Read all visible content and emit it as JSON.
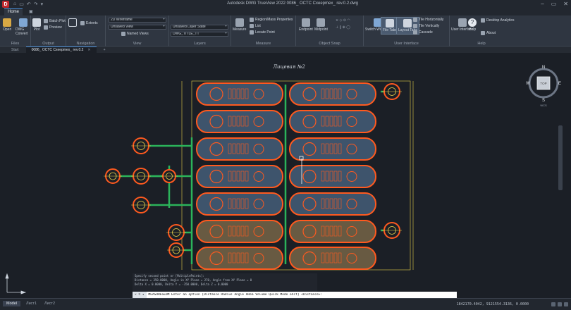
{
  "app": {
    "logo_letter": "D",
    "window_title": "Autodesk DWG TrueView 2022   0086_ OCTC Cxeepmex_ rev.0.2.dwg",
    "quick_access": [
      "⌂",
      "▭",
      "↶",
      "↷",
      "▾"
    ]
  },
  "ribbon_tabs": [
    {
      "label": "Home",
      "active": true
    },
    {
      "label": "▣",
      "active": false
    }
  ],
  "ribbon": {
    "files": {
      "label": "Files",
      "open": "Open",
      "dwg_convert": "DWG Convert"
    },
    "output": {
      "label": "Output",
      "plot": "Plot",
      "batch_plot": "Batch Plot",
      "preview": "Preview"
    },
    "navigation": {
      "label": "Navigation",
      "extents": "Extents"
    },
    "view": {
      "label": "View",
      "visual_style": "2D Wireframe",
      "views": "Unsaved View",
      "named_views": "Named Views"
    },
    "layers": {
      "label": "Layers",
      "layer_state": "Unsaved Layer State",
      "current_layer": "DWG_TITLE_TT"
    },
    "measure": {
      "label": "Measure",
      "measure": "Measure",
      "region_mass": "Region/Mass Properties",
      "list": "List",
      "locate_point": "Locate Point"
    },
    "osnap": {
      "label": "Object Snap",
      "endpoint": "Endpoint",
      "midpoint": "Midpoint"
    },
    "user_interface": {
      "label": "User Interface",
      "switch_windows": "Switch Windows",
      "file_tabs": "File Tabs",
      "layout_tabs": "Layout Tabs",
      "tile_h": "Tile Horizontally",
      "tile_v": "Tile Vertically",
      "cascade": "Cascade"
    },
    "help": {
      "label": "Help",
      "user_interface": "User Interface",
      "help": "Help",
      "desktop_analytics": "Desktop Analytics",
      "about": "About"
    }
  },
  "doc_tabs": [
    {
      "label": "Start",
      "active": false
    },
    {
      "label": "0086_ OCTC Cxeepmex_ rev.0.2",
      "active": true
    },
    {
      "label": "+",
      "active": false
    }
  ],
  "drawing": {
    "title": "Лицевая №2"
  },
  "viewcube": {
    "north": "N",
    "south": "S",
    "east": "E",
    "west": "W",
    "face": "TOP",
    "wcs": "WCS"
  },
  "command": {
    "history": [
      "Specify second point or [MultiplePoints]:",
      "Distance = 350.0000,  Angle in XY Plane = 270,  Angle from XY Plane = 0",
      "Delta X = 0.0000,  Delta Y = -350.0000,  Delta Z = 0.0000"
    ],
    "prefix": "× ↯ ▾",
    "prompt": "MEASUREGEOM Enter an option [Distance Radius Angle ARea Volume Quick Mode eXit] <Distance>:"
  },
  "status": {
    "layouts": [
      {
        "label": "Model",
        "active": true
      },
      {
        "label": "Лист1",
        "active": false
      },
      {
        "label": "Лист2",
        "active": false
      }
    ],
    "coords": "1842170.4042, 9121554.3136, 0.0000"
  },
  "colors": {
    "orange": "#ff5a1f",
    "tank_blue": "#5b7fa6",
    "tank_tan": "#a88a5a",
    "pipe_green": "#2bb35a",
    "yellow": "#e8d24a",
    "background": "#1b1f26"
  }
}
